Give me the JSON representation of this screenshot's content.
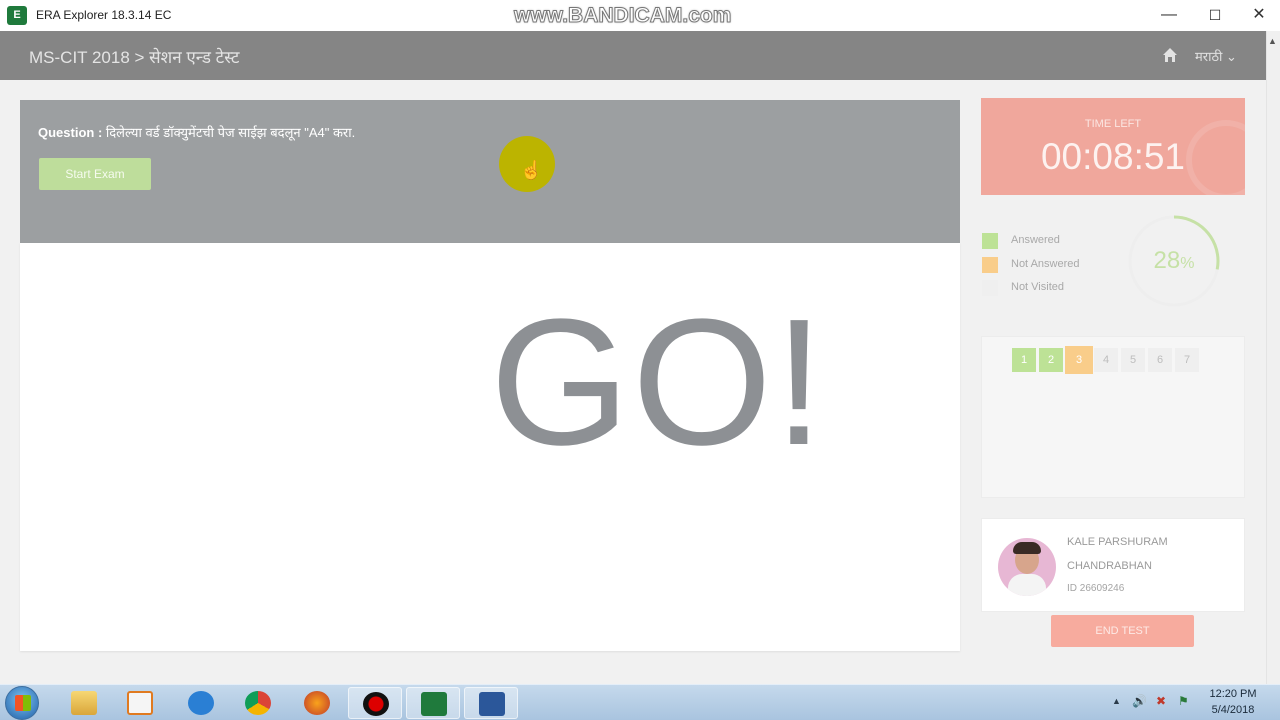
{
  "window": {
    "app_title": "ERA Explorer 18.3.14 EC",
    "watermark": "www.BANDICAM.com",
    "minimize": "—",
    "maximize": "☐",
    "close": "✕"
  },
  "header": {
    "breadcrumb": "MS-CIT 2018 > सेशन एन्ड टेस्ट",
    "language": "मराठी ⌄"
  },
  "question": {
    "label": "Question :",
    "text": "दिलेल्या वर्ड डॉक्युमेंटची पेज साईझ बदलून \"A4\" करा.",
    "start_button": "Start Exam"
  },
  "content": {
    "go_text": "GO!"
  },
  "timer": {
    "label": "TIME LEFT",
    "value": "00:08:51"
  },
  "legend": [
    {
      "label": "Answered",
      "color": "#bde296"
    },
    {
      "label": "Not Answered",
      "color": "#f9cd8a"
    },
    {
      "label": "Not Visited",
      "color": "#efefef"
    }
  ],
  "progress": {
    "value": "28",
    "unit": "%",
    "fraction": 0.28,
    "color": "#c6e1a6"
  },
  "question_nav": [
    {
      "num": "1",
      "state": "answered"
    },
    {
      "num": "2",
      "state": "answered"
    },
    {
      "num": "3",
      "state": "current"
    },
    {
      "num": "4",
      "state": "not-visited"
    },
    {
      "num": "5",
      "state": "not-visited"
    },
    {
      "num": "6",
      "state": "not-visited"
    },
    {
      "num": "7",
      "state": "not-visited"
    }
  ],
  "user": {
    "name_line1": "KALE PARSHURAM",
    "name_line2": "CHANDRABHAN",
    "id": "ID 26609246",
    "end_button": "END TEST"
  },
  "taskbar": {
    "apps": [
      "windows-explorer",
      "media-player",
      "internet-explorer",
      "chrome",
      "firefox",
      "bandicam-record",
      "era-explorer",
      "word"
    ],
    "time": "12:20 PM",
    "date": "5/4/2018"
  },
  "colors": {
    "header": "#858585",
    "timer": "#f0a79c",
    "end_button": "#f7ab9e",
    "start_button": "#bedd9b"
  }
}
